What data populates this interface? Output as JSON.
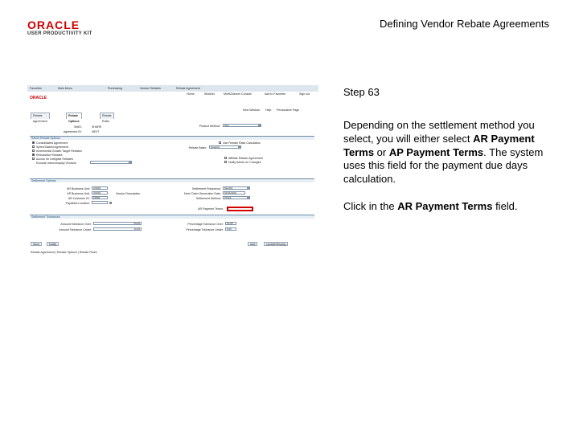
{
  "slide": {
    "title": "Defining Vendor Rebate Agreements",
    "logo_brand": "ORACLE",
    "logo_sub": "USER PRODUCTIVITY KIT"
  },
  "step": {
    "label": "Step 63",
    "desc_1": "Depending on the settlement method you select, you will either select ",
    "desc_ar": "AR Payment Terms",
    "desc_2": " or ",
    "desc_ap": "AP Payment Terms",
    "desc_3": ". The system uses this field for the payment due days calculation.",
    "instr_1": "Click in the ",
    "instr_field": "AR Payment Terms",
    "instr_2": " field."
  },
  "screenshot": {
    "breadcrumb": [
      "Favorites",
      "Main Menu",
      "Purchasing",
      "Vendor Rebates",
      "Rebate Agreement"
    ],
    "oracle": "ORACLE",
    "navlinks": [
      "Home",
      "Worklist",
      "MultiChannel Console",
      "Add to Favorites",
      "Sign out"
    ],
    "toplinks": [
      "New Window",
      "Help",
      "Personalize Page"
    ],
    "tabs": [
      "Rebate Agreement",
      "Rebate Options",
      "Rebate Rules"
    ],
    "setid_label": "SetID:",
    "setid_value": "SHARE",
    "agreement_label": "Agreement ID:",
    "agreement_value": "NEXT",
    "prod_label": "Product Method:",
    "prod_value": "Item",
    "section_rebate": "Select Rebate Options",
    "opt_consol": "Consolidated Agreement",
    "opt_spend": "Spend Based Agreement",
    "opt_inc": "Incremental Growth Target Rebates",
    "opt_retro": "Retroactive Rebates",
    "opt_accrue": "Accrue for Ineligible Rebates",
    "opt_exclude": "Exclude Intercompany Vendors",
    "opt_pass": "Use Rebate Ratio Calculation",
    "opt_aff": "Affiliate Rebate Agreement",
    "opt_notify": "Notify Admin on Changes",
    "rebate_basis_label": "Rebate Basis:",
    "rebate_basis_value": "Quantity",
    "section_settle": "Settlement Options",
    "ar_bu_label": "AR Business Unit:",
    "ar_bu_value": "US001",
    "ap_bu_label": "AP Business Unit:",
    "ap_bu_value": "US001",
    "ar_cust_label": "AR Customer ID:",
    "ar_cust_value": "10500",
    "payables_label": "Payables Location:",
    "freq_label": "Settlement Frequency:",
    "freq_value": "Monthly",
    "next_label": "Next Claim Generation Date:",
    "next_value": "01/31/2010",
    "method_label": "Settlement Method:",
    "method_value": "Check",
    "arterms_label": "AR Payment Terms:",
    "vendor_desc": "Vendor Description",
    "section_tol": "Settlement Tolerances",
    "amt_over_label": "Amount Tolerance Over:",
    "amt_over_value": "50.00",
    "amt_under_label": "Amount Tolerance Under:",
    "amt_under_value": "10.00",
    "pct_over_label": "Percentage Tolerance Over:",
    "pct_over_value": "10.00",
    "pct_under_label": "Percentage Tolerance Under:",
    "pct_under_value": "5.00",
    "buttons": [
      "Save",
      "Notify",
      "Add",
      "Update/Display"
    ],
    "footer": "Rebate Agreement | Rebate Options | Rebate Rules"
  }
}
